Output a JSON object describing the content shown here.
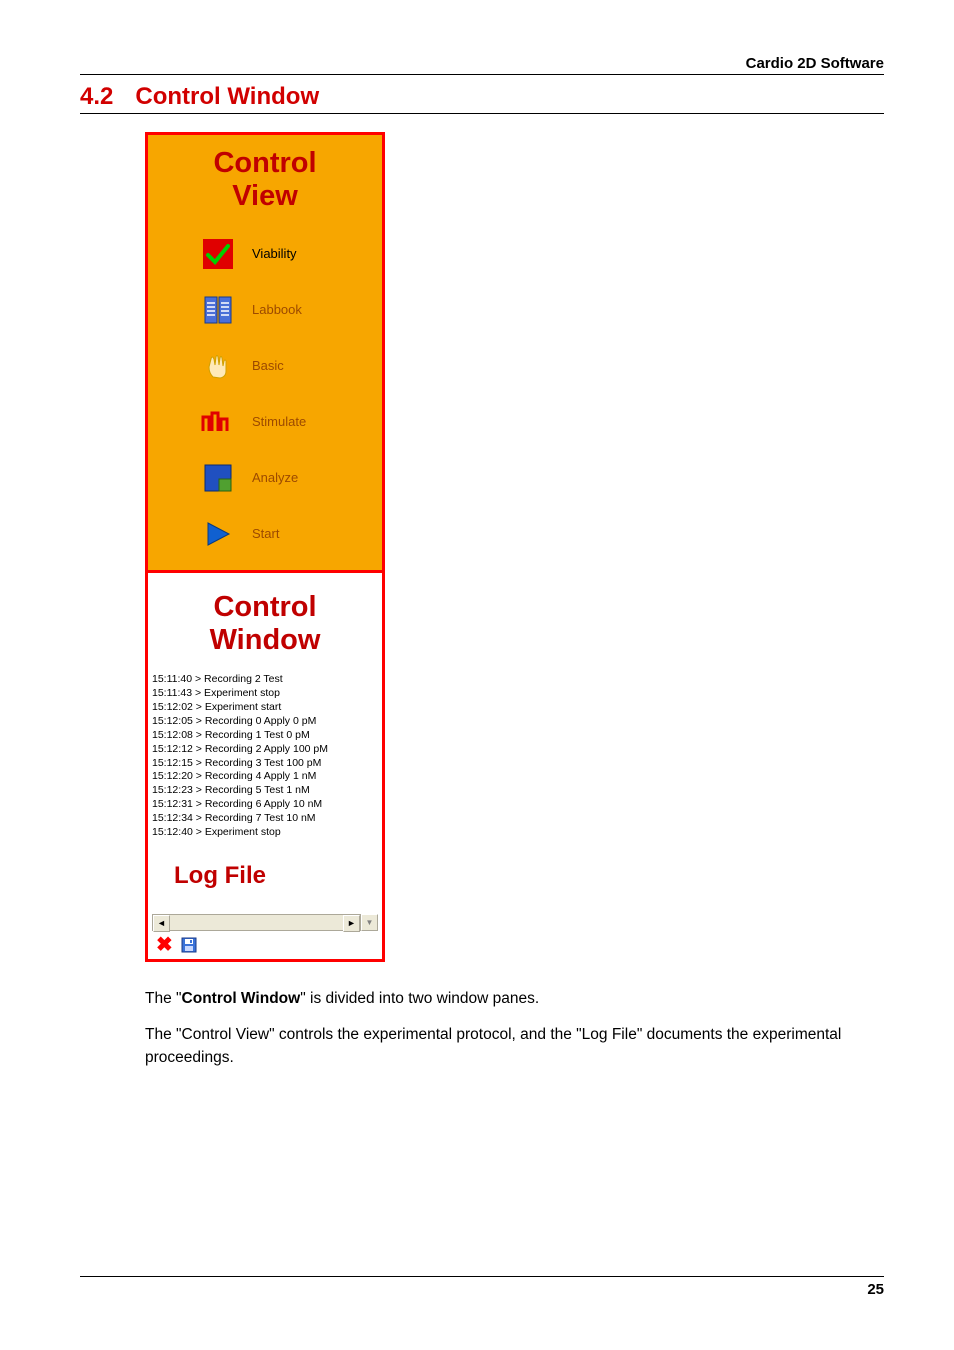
{
  "header": {
    "right": "Cardio 2D Software"
  },
  "section": {
    "number": "4.2",
    "title": "Control Window"
  },
  "control_view": {
    "title_line1": "Control",
    "title_line2": "View",
    "items": [
      {
        "label": "Viability",
        "icon": "check-icon"
      },
      {
        "label": "Labbook",
        "icon": "labbook-icon"
      },
      {
        "label": "Basic",
        "icon": "hand-icon"
      },
      {
        "label": "Stimulate",
        "icon": "stimulate-icon"
      },
      {
        "label": "Analyze",
        "icon": "analyze-icon"
      },
      {
        "label": "Start",
        "icon": "play-icon"
      }
    ]
  },
  "control_window_label": {
    "line1": "Control",
    "line2": "Window"
  },
  "log": {
    "lines": [
      "15:11:40 >  Recording 2  Test",
      "15:11:43 >  Experiment stop",
      "15:12:02 >  Experiment start",
      "15:12:05 >  Recording 0  Apply  0 pM",
      "15:12:08 >  Recording 1  Test  0 pM",
      "15:12:12 >  Recording 2  Apply  100 pM",
      "15:12:15 >  Recording 3  Test  100 pM",
      "15:12:20 >  Recording 4  Apply  1 nM",
      "15:12:23 >  Recording 5  Test  1 nM",
      "15:12:31 >  Recording 6  Apply  10 nM",
      "15:12:34 >  Recording 7  Test  10 nM",
      "15:12:40 >  Experiment stop"
    ],
    "title": "Log File"
  },
  "paragraphs": {
    "p1_pre": "The \"",
    "p1_bold": "Control Window",
    "p1_post": "\" is divided into two window panes.",
    "p2": "The \"Control View\" controls the experimental protocol, and the \"Log File\" documents the experimental proceedings."
  },
  "footer": {
    "page": "25"
  },
  "glyphs": {
    "left_arrow": "◄",
    "right_arrow": "►",
    "down_arrow": "▼"
  }
}
